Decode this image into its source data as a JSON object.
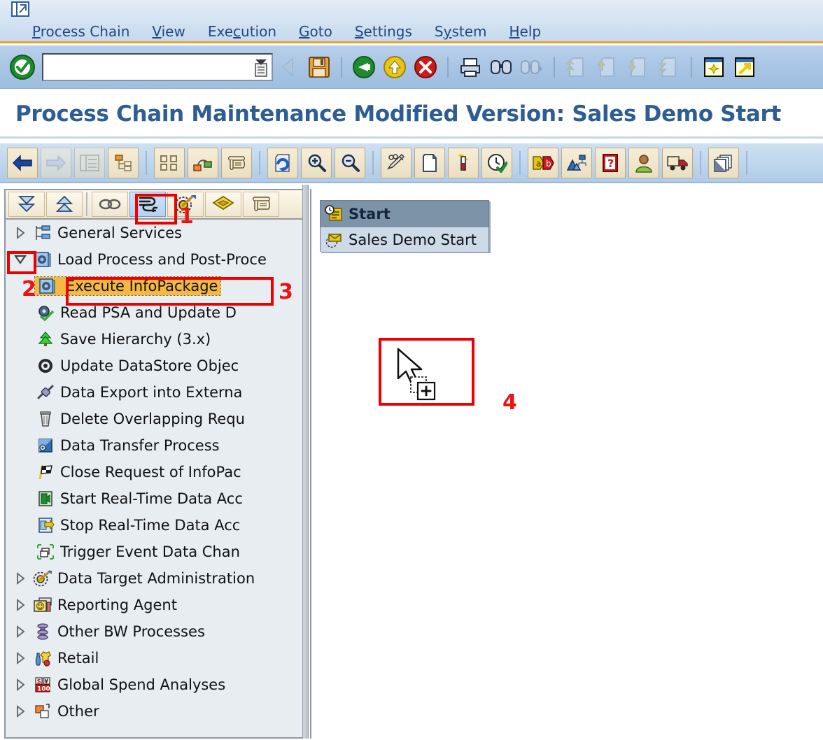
{
  "window": {
    "title": "Process Chain Maintenance Modified Version: Sales Demo Start",
    "restore_icon": "window-restore-icon"
  },
  "menu": {
    "items": [
      {
        "label": "Process Chain",
        "accel": "P",
        "name": "menu-process-chain"
      },
      {
        "label": "View",
        "accel": "V",
        "name": "menu-view"
      },
      {
        "label": "Execution",
        "accel": "c",
        "name": "menu-execution"
      },
      {
        "label": "Goto",
        "accel": "G",
        "name": "menu-goto"
      },
      {
        "label": "Settings",
        "accel": "S",
        "name": "menu-settings"
      },
      {
        "label": "System",
        "accel": "y",
        "name": "menu-system"
      },
      {
        "label": "Help",
        "accel": "H",
        "name": "menu-help"
      }
    ]
  },
  "system_toolbar": {
    "ok_icon": "enter-check-icon",
    "command_field": {
      "value": "",
      "placeholder": ""
    },
    "buttons": [
      {
        "icon": "back-arrow-gray-icon",
        "enabled": false
      },
      {
        "icon": "save-icon",
        "enabled": true
      },
      {
        "icon": "back-green-icon",
        "enabled": true
      },
      {
        "icon": "exit-yellow-icon",
        "enabled": true
      },
      {
        "icon": "cancel-red-icon",
        "enabled": true
      },
      {
        "icon": "print-icon",
        "enabled": true
      },
      {
        "icon": "find-icon",
        "enabled": true
      },
      {
        "icon": "find-next-icon",
        "enabled": false
      },
      {
        "icon": "first-page-icon",
        "enabled": false
      },
      {
        "icon": "previous-page-icon",
        "enabled": false
      },
      {
        "icon": "next-page-icon",
        "enabled": false
      },
      {
        "icon": "last-page-icon",
        "enabled": false
      },
      {
        "icon": "create-session-icon",
        "enabled": true
      },
      {
        "icon": "create-shortcut-icon",
        "enabled": true
      }
    ]
  },
  "app_toolbar": {
    "buttons": [
      {
        "icon": "back-blue-arrow-icon",
        "name": "app-back-button",
        "enabled": true
      },
      {
        "icon": "forward-gray-arrow-icon",
        "name": "app-forward-button",
        "enabled": false
      },
      {
        "icon": "list-view-icon",
        "name": "app-list-view-button",
        "enabled": false
      },
      {
        "icon": "tree-view-icon",
        "name": "app-tree-view-button",
        "enabled": true
      },
      {
        "icon": "planning-view-icon",
        "name": "app-planning-view-button",
        "enabled": true
      },
      {
        "icon": "process-chain-icon",
        "name": "app-process-chain-button",
        "enabled": true
      },
      {
        "icon": "log-scroll-icon",
        "name": "app-log-button",
        "enabled": true
      },
      {
        "icon": "refresh-icon",
        "name": "app-refresh-button",
        "enabled": true
      },
      {
        "icon": "zoom-in-icon",
        "name": "app-zoom-in-button",
        "enabled": true
      },
      {
        "icon": "zoom-out-icon",
        "name": "app-zoom-out-button",
        "enabled": true
      },
      {
        "icon": "checking-pen-icon",
        "name": "app-check-button",
        "enabled": true
      },
      {
        "icon": "new-document-icon",
        "name": "app-new-button",
        "enabled": true
      },
      {
        "icon": "attributes-icon",
        "name": "app-attributes-button",
        "enabled": true
      },
      {
        "icon": "schedule-clock-icon",
        "name": "app-schedule-button",
        "enabled": true
      },
      {
        "icon": "a-to-b-icon",
        "name": "app-translate-button",
        "enabled": true
      },
      {
        "icon": "network-display-icon",
        "name": "app-network-button",
        "enabled": true
      },
      {
        "icon": "documentation-icon",
        "name": "app-documentation-button",
        "enabled": true
      },
      {
        "icon": "user-icon",
        "name": "app-user-button",
        "enabled": true
      },
      {
        "icon": "transport-truck-icon",
        "name": "app-transport-button",
        "enabled": true
      },
      {
        "icon": "layers-icon",
        "name": "app-layers-button",
        "enabled": true
      }
    ]
  },
  "tree_toolbar": {
    "buttons": [
      {
        "icon": "expand-all-icon",
        "name": "tree-expand-all-button",
        "active": false
      },
      {
        "icon": "collapse-all-icon",
        "name": "tree-collapse-all-button",
        "active": false
      },
      {
        "icon": "link-chain-icon",
        "name": "tree-link-button",
        "active": false
      },
      {
        "icon": "process-types-icon",
        "name": "tree-process-types-button",
        "active": true
      },
      {
        "icon": "target-dart-icon",
        "name": "tree-target-button",
        "active": false
      },
      {
        "icon": "package-cube-icon",
        "name": "tree-package-button",
        "active": false
      },
      {
        "icon": "scroll-log-icon",
        "name": "tree-log-button",
        "active": false
      }
    ]
  },
  "tree": {
    "items": [
      {
        "label": "General Services",
        "icon": "general-services-icon",
        "level": 0,
        "expander": "collapsed",
        "selected": false
      },
      {
        "label": "Load Process and Post-Proce",
        "icon": "load-process-gear-icon",
        "level": 0,
        "expander": "expanded",
        "selected": false
      },
      {
        "label": "Execute InfoPackage",
        "icon": "execute-infopackage-gear-icon",
        "level": 1,
        "expander": "none",
        "selected": true
      },
      {
        "label": "Read PSA and Update D",
        "icon": "read-psa-icon",
        "level": 1,
        "expander": "none",
        "selected": false
      },
      {
        "label": "Save Hierarchy (3.x)",
        "icon": "save-hierarchy-tree-icon",
        "level": 1,
        "expander": "none",
        "selected": false
      },
      {
        "label": "Update DataStore Objec",
        "icon": "update-datastore-gear-icon",
        "level": 1,
        "expander": "none",
        "selected": false
      },
      {
        "label": "Data Export into Externa",
        "icon": "data-export-plug-icon",
        "level": 1,
        "expander": "none",
        "selected": false
      },
      {
        "label": "Delete Overlapping Requ",
        "icon": "delete-trash-icon",
        "level": 1,
        "expander": "none",
        "selected": false
      },
      {
        "label": "Data Transfer Process",
        "icon": "data-transfer-process-icon",
        "level": 1,
        "expander": "none",
        "selected": false
      },
      {
        "label": "Close Request of InfoPac",
        "icon": "close-request-flag-icon",
        "level": 1,
        "expander": "none",
        "selected": false
      },
      {
        "label": "Start Real-Time Data Acc",
        "icon": "start-rda-icon",
        "level": 1,
        "expander": "none",
        "selected": false
      },
      {
        "label": "Stop Real-Time Data Acc",
        "icon": "stop-rda-icon",
        "level": 1,
        "expander": "none",
        "selected": false
      },
      {
        "label": "Trigger Event Data Chan",
        "icon": "trigger-event-icon",
        "level": 1,
        "expander": "none",
        "selected": false
      },
      {
        "label": "Data Target Administration",
        "icon": "data-target-dart-icon",
        "level": 0,
        "expander": "collapsed",
        "selected": false
      },
      {
        "label": "Reporting Agent",
        "icon": "reporting-agent-smiley-icon",
        "level": 0,
        "expander": "collapsed",
        "selected": false
      },
      {
        "label": "Other BW Processes",
        "icon": "other-bw-processes-icon",
        "level": 0,
        "expander": "collapsed",
        "selected": false
      },
      {
        "label": "Retail",
        "icon": "retail-icon",
        "level": 0,
        "expander": "collapsed",
        "selected": false
      },
      {
        "label": "Global Spend Analyses",
        "icon": "global-spend-analyses-icon",
        "level": 0,
        "expander": "collapsed",
        "selected": false
      },
      {
        "label": "Other",
        "icon": "other-squares-icon",
        "level": 0,
        "expander": "collapsed",
        "selected": false
      }
    ]
  },
  "canvas": {
    "start_node": {
      "header_label": "Start",
      "header_icon": "start-clock-icon",
      "body_label": "Sales Demo Start",
      "body_icon": "start-variant-icon"
    },
    "cursor": {
      "icon": "drag-drop-plus-cursor-icon"
    }
  },
  "annotations": [
    {
      "number": "1",
      "name": "annotation-1",
      "target": "tree-process-types-button"
    },
    {
      "number": "2",
      "name": "annotation-2",
      "target": "tree-expander-load-process"
    },
    {
      "number": "3",
      "name": "annotation-3",
      "target": "tree-item-execute-infopackage"
    },
    {
      "number": "4",
      "name": "annotation-4",
      "target": "canvas-drop-cursor"
    }
  ],
  "colors": {
    "annotation_red": "#ee0000",
    "selection_amber": "#f5b942",
    "title_blue": "#2e5d93",
    "menu_blue": "#23477e",
    "toolbar_accent": "#f0a030",
    "node_header": "#7d93a7",
    "node_body": "#cddbe8"
  }
}
